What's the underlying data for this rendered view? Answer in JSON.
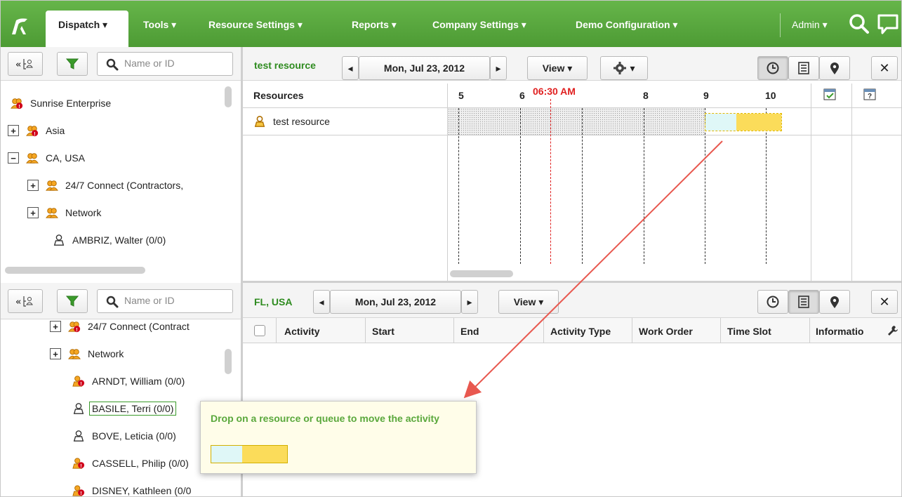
{
  "nav": {
    "items": [
      {
        "label": "Dispatch ▾"
      },
      {
        "label": "Tools ▾"
      },
      {
        "label": "Resource Settings ▾"
      },
      {
        "label": "Reports ▾"
      },
      {
        "label": "Company Settings ▾"
      },
      {
        "label": "Demo Configuration ▾"
      }
    ],
    "admin_label": "Admin ▾"
  },
  "top_left": {
    "search_placeholder": "Name or ID",
    "tree": [
      {
        "label": "Sunrise Enterprise",
        "icon": "group-alert-icon"
      },
      {
        "label": "Asia",
        "icon": "group-alert-icon",
        "expander": "+"
      },
      {
        "label": "CA, USA",
        "icon": "group-icon",
        "expander": "−"
      },
      {
        "label": "24/7 Connect (Contractors,",
        "icon": "group-icon",
        "expander": "+"
      },
      {
        "label": "Network",
        "icon": "group-icon",
        "expander": "+"
      },
      {
        "label": "AMBRIZ, Walter (0/0)",
        "icon": "person-icon"
      }
    ]
  },
  "top_right": {
    "title": "test resource",
    "date": "Mon, Jul 23, 2012",
    "view_label": "View ▾",
    "gear_label": "▾",
    "grid": {
      "resources_header": "Resources",
      "hours": [
        "5",
        "6",
        "8",
        "9",
        "10"
      ],
      "current_time": "06:30 AM",
      "row_label": "test resource"
    }
  },
  "bottom_left": {
    "search_placeholder": "Name or ID",
    "tree": [
      {
        "label": "24/7 Connect (Contract",
        "icon": "group-alert-icon",
        "expander": "+"
      },
      {
        "label": "Network",
        "icon": "group-icon",
        "expander": "+"
      },
      {
        "label": "ARNDT, William (0/0)",
        "icon": "person-alert-icon"
      },
      {
        "label": "BASILE, Terri (0/0)",
        "icon": "person-icon"
      },
      {
        "label": "BOVE, Leticia (0/0)",
        "icon": "person-icon"
      },
      {
        "label": "CASSELL, Philip (0/0)",
        "icon": "person-alert-icon"
      },
      {
        "label": "DISNEY, Kathleen (0/0",
        "icon": "person-alert-icon"
      }
    ]
  },
  "bottom_right": {
    "title": "FL, USA",
    "date": "Mon, Jul 23, 2012",
    "view_label": "View ▾",
    "columns": [
      "Activity",
      "Start",
      "End",
      "Activity Type",
      "Work Order",
      "Time Slot",
      "Informatio"
    ]
  },
  "tooltip": {
    "message": "Drop on a resource or queue to move the activity"
  },
  "colors": {
    "nav_green": "#5aab3f",
    "accent_green": "#2e8b1f",
    "current_time_red": "#e02020",
    "activity_cyan": "#dff7f7",
    "activity_yellow": "#fbdc5a",
    "arrow_red": "#e8584f"
  }
}
